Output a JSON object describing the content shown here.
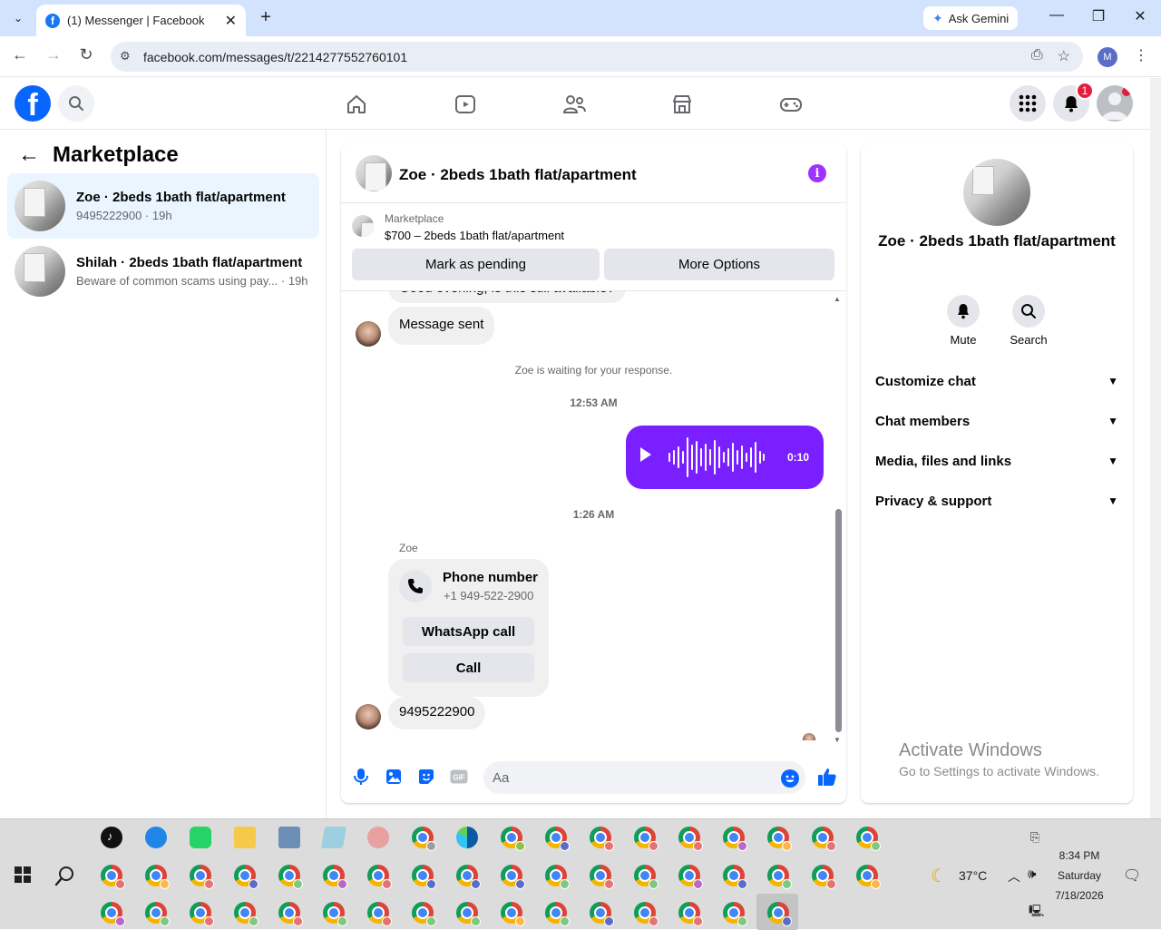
{
  "browser": {
    "tab_title": "(1) Messenger | Facebook",
    "ask_gemini": "Ask Gemini",
    "url": "facebook.com/messages/t/2214277552760101",
    "profile_initial": "M"
  },
  "fb": {
    "logo": "f",
    "notifications_count": "1"
  },
  "left": {
    "back_arrow": "←",
    "title": "Marketplace",
    "conversations": [
      {
        "name": "Zoe · 2beds 1bath flat/apartment",
        "preview": "9495222900 · 19h"
      },
      {
        "name": "Shilah · 2beds 1bath flat/apartment",
        "preview": "Beware of common scams using pay... · 19h"
      }
    ]
  },
  "chat": {
    "header_title": "Zoe · 2beds 1bath flat/apartment",
    "info": "i",
    "listing_source": "Marketplace",
    "listing_title": "$700 – 2beds 1bath flat/apartment",
    "mark_pending": "Mark as pending",
    "more_options": "More Options",
    "partial_message": "Good evening, is this still available?",
    "message_sent": "Message sent",
    "waiting": "Zoe is waiting for your response.",
    "time1": "12:53 AM",
    "voice_duration": "0:10",
    "time2": "1:26 AM",
    "sender_name": "Zoe",
    "phone_card": {
      "title": "Phone number",
      "number": "+1 949-522-2900",
      "whatsapp": "WhatsApp call",
      "call": "Call"
    },
    "last_message": "9495222900",
    "input_placeholder": "Aa"
  },
  "right": {
    "title": "Zoe · 2beds 1bath flat/apartment",
    "mute": "Mute",
    "search": "Search",
    "sections": [
      "Customize chat",
      "Chat members",
      "Media, files and links",
      "Privacy & support"
    ]
  },
  "watermark": {
    "line1": "Activate Windows",
    "line2": "Go to Settings to activate Windows."
  },
  "taskbar": {
    "weather": "37°C",
    "time": "8:34 PM",
    "day": "Saturday",
    "date": "7/18/2026"
  },
  "colors": {
    "fb_blue": "#0866ff",
    "messenger_purple": "#7a1fff",
    "active_conv": "#ebf5ff"
  }
}
